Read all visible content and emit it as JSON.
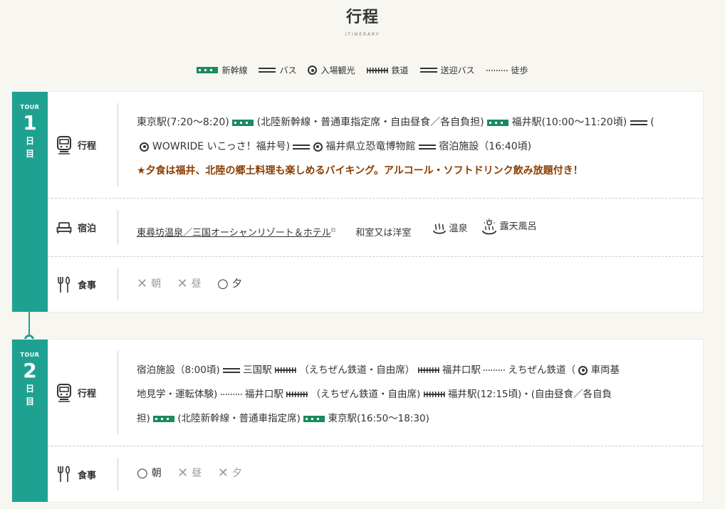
{
  "header": {
    "title": "行程",
    "subtitle": "ITINERARY"
  },
  "legend": [
    {
      "symbol": "shinkansen",
      "label": "新幹線"
    },
    {
      "symbol": "bus",
      "label": "バス"
    },
    {
      "symbol": "admission",
      "label": "入場観光"
    },
    {
      "symbol": "rail",
      "label": "鉄道"
    },
    {
      "symbol": "bus",
      "label": "送迎バス"
    },
    {
      "symbol": "walk",
      "label": "徒歩"
    }
  ],
  "days": [
    {
      "tour_label": "TOUR",
      "num": "1",
      "nichi_1": "日",
      "nichi_2": "目",
      "itinerary_label": "行程",
      "itinerary": {
        "t1": "東京駅(7:20〜8:20)",
        "t2": "(北陸新幹線・普通車指定席・自由昼食／各自負担)",
        "t3": "福井駅(10:00〜11:20頃)",
        "t4": "(",
        "t5": "WOWRIDE いこっさ！福井号)",
        "t6": "福井県立恐竜博物館",
        "t7": "宿泊施設（16:40頃)",
        "notice": "★夕食は福井、北陸の郷土料理も楽しめるバイキング。アルコール・ソフトドリンク飲み放題付き！"
      },
      "stay_label": "宿泊",
      "stay": {
        "hotel": "東尋坊温泉／三国オーシャンリゾート＆ホテル",
        "room": "和室又は洋室",
        "onsen": "温泉",
        "rotenburo": "露天風呂"
      },
      "meal_label": "食事",
      "meals": [
        {
          "mark": "✕",
          "name": "朝"
        },
        {
          "mark": "✕",
          "name": "昼"
        },
        {
          "mark": "○",
          "name": "夕"
        }
      ]
    },
    {
      "tour_label": "TOUR",
      "num": "2",
      "nichi_1": "日",
      "nichi_2": "目",
      "itinerary_label": "行程",
      "itinerary": {
        "t1": "宿泊施設（8:00頃)",
        "t2": "三国駅",
        "t3": "（えちぜん鉄道・自由席）",
        "t4": "福井口駅",
        "t5": "えちぜん鉄道（",
        "t6": "車両基",
        "t7": "地見学・運転体験)",
        "t8": "福井口駅",
        "t9": "（えちぜん鉄道・自由席)",
        "t10": "福井駅(12:15頃)・(自由昼食／各自負",
        "t11": "担)",
        "t12": "(北陸新幹線・普通車指定席)",
        "t13": "東京駅(16:50〜18:30)"
      },
      "meal_label": "食事",
      "meals": [
        {
          "mark": "○",
          "name": "朝"
        },
        {
          "mark": "✕",
          "name": "昼"
        },
        {
          "mark": "✕",
          "name": "夕"
        }
      ]
    }
  ]
}
